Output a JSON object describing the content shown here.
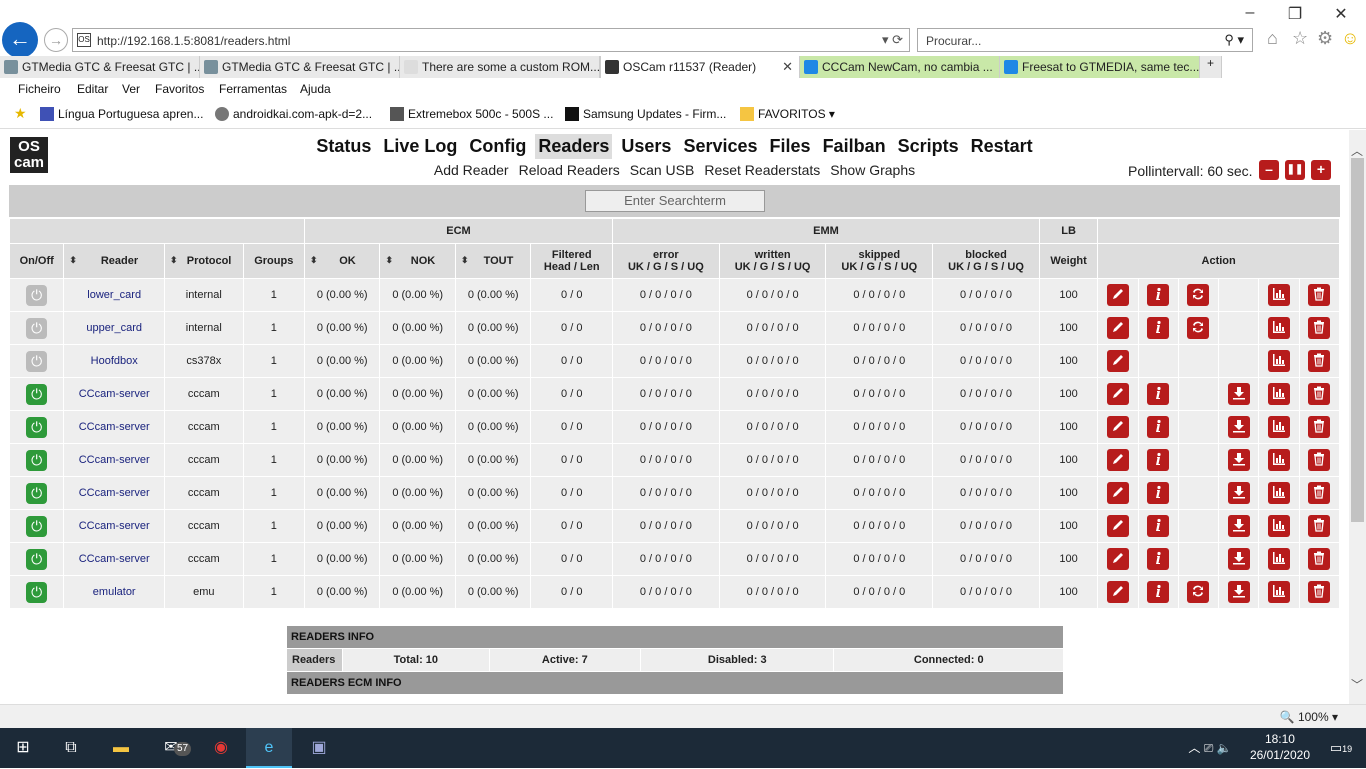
{
  "browser": {
    "url": "http://192.168.1.5:8081/readers.html",
    "search_placeholder": "Procurar...",
    "tabs": [
      {
        "label": "GTMedia GTC & Freesat GTC | ..."
      },
      {
        "label": "GTMedia GTC & Freesat GTC | ..."
      },
      {
        "label": "There are some a custom ROM..."
      },
      {
        "label": "OSCam r11537 (Reader)"
      },
      {
        "label": "CCCam NewCam, no cambia ..."
      },
      {
        "label": "Freesat to GTMEDIA, same tec..."
      }
    ],
    "menu": [
      "Ficheiro",
      "Editar",
      "Ver",
      "Favoritos",
      "Ferramentas",
      "Ajuda"
    ],
    "favorites": [
      "Língua Portuguesa  apren...",
      "androidkai.com-apk-d=2...",
      "Extremebox 500c - 500S ...",
      "Samsung Updates - Firm...",
      "FAVORITOS"
    ],
    "zoom": "100%"
  },
  "oscam": {
    "logo_top": "OS",
    "logo_bottom": "cam",
    "nav": [
      "Status",
      "Live Log",
      "Config",
      "Readers",
      "Users",
      "Services",
      "Files",
      "Failban",
      "Scripts",
      "Restart"
    ],
    "subnav": [
      "Add Reader",
      "Reload Readers",
      "Scan USB",
      "Reset Readerstats",
      "Show Graphs"
    ],
    "pollinterval": "Pollintervall: 60 sec.",
    "search_placeholder": "Enter Searchterm",
    "group_headers": {
      "ecm": "ECM",
      "emm": "EMM",
      "lb": "LB"
    },
    "columns": {
      "onoff": "On/Off",
      "reader": "Reader",
      "protocol": "Protocol",
      "groups": "Groups",
      "ok": "OK",
      "nok": "NOK",
      "tout": "TOUT",
      "filtered_1": "Filtered",
      "filtered_2": "Head / Len",
      "error": "error",
      "written": "written",
      "skipped": "skipped",
      "blocked": "blocked",
      "uk": "UK / G / S / UQ",
      "weight": "Weight",
      "action": "Action"
    },
    "readers": [
      {
        "on": false,
        "name": "lower_card",
        "protocol": "internal",
        "groups": "1",
        "ok": "0 (0.00 %)",
        "nok": "0 (0.00 %)",
        "tout": "0 (0.00 %)",
        "filtered": "0 / 0",
        "error": "0 / 0 / 0 / 0",
        "written": "0 / 0 / 0 / 0",
        "skipped": "0 / 0 / 0 / 0",
        "blocked": "0 / 0 / 0 / 0",
        "weight": "100",
        "actions": [
          "edit",
          "info",
          "refresh",
          "",
          "stats",
          "delete"
        ]
      },
      {
        "on": false,
        "name": "upper_card",
        "protocol": "internal",
        "groups": "1",
        "ok": "0 (0.00 %)",
        "nok": "0 (0.00 %)",
        "tout": "0 (0.00 %)",
        "filtered": "0 / 0",
        "error": "0 / 0 / 0 / 0",
        "written": "0 / 0 / 0 / 0",
        "skipped": "0 / 0 / 0 / 0",
        "blocked": "0 / 0 / 0 / 0",
        "weight": "100",
        "actions": [
          "edit",
          "info",
          "refresh",
          "",
          "stats",
          "delete"
        ]
      },
      {
        "on": false,
        "name": "Hoofdbox",
        "protocol": "cs378x",
        "groups": "1",
        "ok": "0 (0.00 %)",
        "nok": "0 (0.00 %)",
        "tout": "0 (0.00 %)",
        "filtered": "0 / 0",
        "error": "0 / 0 / 0 / 0",
        "written": "0 / 0 / 0 / 0",
        "skipped": "0 / 0 / 0 / 0",
        "blocked": "0 / 0 / 0 / 0",
        "weight": "100",
        "actions": [
          "edit",
          "",
          "",
          "",
          "stats",
          "delete"
        ]
      },
      {
        "on": true,
        "name": "CCcam-server",
        "protocol": "cccam",
        "groups": "1",
        "ok": "0 (0.00 %)",
        "nok": "0 (0.00 %)",
        "tout": "0 (0.00 %)",
        "filtered": "0 / 0",
        "error": "0 / 0 / 0 / 0",
        "written": "0 / 0 / 0 / 0",
        "skipped": "0 / 0 / 0 / 0",
        "blocked": "0 / 0 / 0 / 0",
        "weight": "100",
        "actions": [
          "edit",
          "info",
          "",
          "download",
          "stats",
          "delete"
        ]
      },
      {
        "on": true,
        "name": "CCcam-server",
        "protocol": "cccam",
        "groups": "1",
        "ok": "0 (0.00 %)",
        "nok": "0 (0.00 %)",
        "tout": "0 (0.00 %)",
        "filtered": "0 / 0",
        "error": "0 / 0 / 0 / 0",
        "written": "0 / 0 / 0 / 0",
        "skipped": "0 / 0 / 0 / 0",
        "blocked": "0 / 0 / 0 / 0",
        "weight": "100",
        "actions": [
          "edit",
          "info",
          "",
          "download",
          "stats",
          "delete"
        ]
      },
      {
        "on": true,
        "name": "CCcam-server",
        "protocol": "cccam",
        "groups": "1",
        "ok": "0 (0.00 %)",
        "nok": "0 (0.00 %)",
        "tout": "0 (0.00 %)",
        "filtered": "0 / 0",
        "error": "0 / 0 / 0 / 0",
        "written": "0 / 0 / 0 / 0",
        "skipped": "0 / 0 / 0 / 0",
        "blocked": "0 / 0 / 0 / 0",
        "weight": "100",
        "actions": [
          "edit",
          "info",
          "",
          "download",
          "stats",
          "delete"
        ]
      },
      {
        "on": true,
        "name": "CCcam-server",
        "protocol": "cccam",
        "groups": "1",
        "ok": "0 (0.00 %)",
        "nok": "0 (0.00 %)",
        "tout": "0 (0.00 %)",
        "filtered": "0 / 0",
        "error": "0 / 0 / 0 / 0",
        "written": "0 / 0 / 0 / 0",
        "skipped": "0 / 0 / 0 / 0",
        "blocked": "0 / 0 / 0 / 0",
        "weight": "100",
        "actions": [
          "edit",
          "info",
          "",
          "download",
          "stats",
          "delete"
        ]
      },
      {
        "on": true,
        "name": "CCcam-server",
        "protocol": "cccam",
        "groups": "1",
        "ok": "0 (0.00 %)",
        "nok": "0 (0.00 %)",
        "tout": "0 (0.00 %)",
        "filtered": "0 / 0",
        "error": "0 / 0 / 0 / 0",
        "written": "0 / 0 / 0 / 0",
        "skipped": "0 / 0 / 0 / 0",
        "blocked": "0 / 0 / 0 / 0",
        "weight": "100",
        "actions": [
          "edit",
          "info",
          "",
          "download",
          "stats",
          "delete"
        ]
      },
      {
        "on": true,
        "name": "CCcam-server",
        "protocol": "cccam",
        "groups": "1",
        "ok": "0 (0.00 %)",
        "nok": "0 (0.00 %)",
        "tout": "0 (0.00 %)",
        "filtered": "0 / 0",
        "error": "0 / 0 / 0 / 0",
        "written": "0 / 0 / 0 / 0",
        "skipped": "0 / 0 / 0 / 0",
        "blocked": "0 / 0 / 0 / 0",
        "weight": "100",
        "actions": [
          "edit",
          "info",
          "",
          "download",
          "stats",
          "delete"
        ]
      },
      {
        "on": true,
        "name": "emulator",
        "protocol": "emu",
        "groups": "1",
        "ok": "0 (0.00 %)",
        "nok": "0 (0.00 %)",
        "tout": "0 (0.00 %)",
        "filtered": "0 / 0",
        "error": "0 / 0 / 0 / 0",
        "written": "0 / 0 / 0 / 0",
        "skipped": "0 / 0 / 0 / 0",
        "blocked": "0 / 0 / 0 / 0",
        "weight": "100",
        "actions": [
          "edit",
          "info",
          "refresh",
          "download",
          "stats",
          "delete"
        ]
      }
    ],
    "readers_info": {
      "title": "READERS INFO",
      "label": "Readers",
      "total": "Total: 10",
      "active": "Active: 7",
      "disabled": "Disabled: 3",
      "connected": "Connected: 0"
    },
    "readers_ecm_info": {
      "title": "READERS ECM INFO"
    }
  },
  "taskbar": {
    "time": "18:10",
    "date": "26/01/2020",
    "mail_badge": "57",
    "notif_count": "19"
  }
}
